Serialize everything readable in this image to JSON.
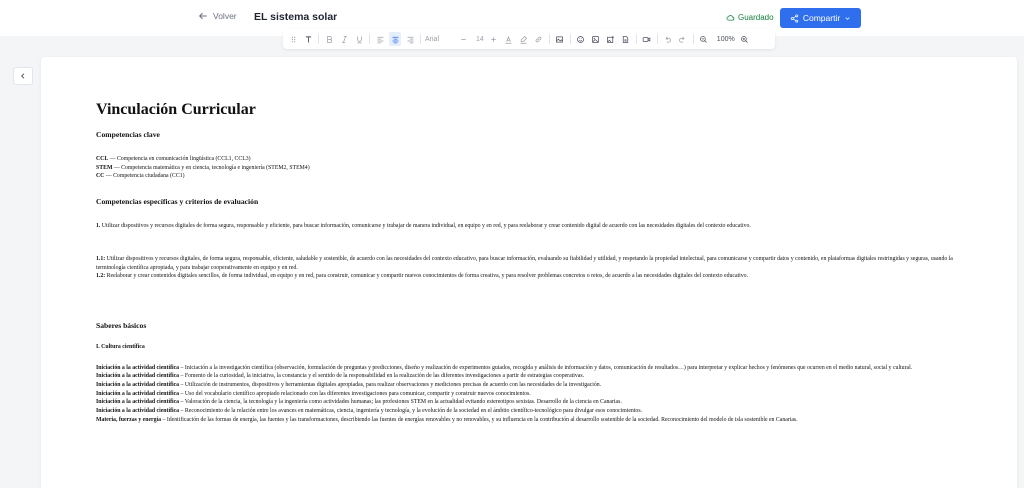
{
  "header": {
    "back_label": "Volver",
    "title": "EL sistema solar",
    "saved_label": "Guardado",
    "share_label": "Compartir"
  },
  "toolbar": {
    "font_name": "Arial",
    "font_size": "14",
    "zoom": "100%"
  },
  "document": {
    "title": "Vinculación Curricular",
    "competencias_clave": {
      "heading": "Competencias clave",
      "items": [
        {
          "code": "CCL",
          "text": " — Competencia en comunicación lingüística (CCL1, CCL3)"
        },
        {
          "code": "STEM",
          "text": " — Competencia matemática y en ciencia, tecnología e ingeniería (STEM2, STEM4)"
        },
        {
          "code": "CC",
          "text": " — Competencia ciudadana (CC1)"
        }
      ]
    },
    "competencias_especificas": {
      "heading": "Competencias específicas y criterios de evaluación",
      "item1": {
        "code": "1.",
        "text": " Utilizar dispositivos y recursos digitales de forma segura, responsable y eficiente, para buscar información, comunicarse y trabajar de manera individual, en equipo y en red, y para reelaborar y crear contenido digital de acuerdo con las necesidades digitales del contexto educativo."
      },
      "criterios": [
        {
          "code": "1.1:",
          "text": " Utilizar dispositivos y recursos digitales, de forma segura, responsable, eficiente, saludable y sostenible, de acuerdo con las necesidades del contexto educativo, para buscar información, evaluando su fiabilidad y utilidad, y respetando la propiedad intelectual, para comunicarse y compartir datos y contenido, en plataformas digitales restringidas y seguras, usando la terminología científica apropiada, y para trabajar cooperativamente en equipo y en red."
        },
        {
          "code": "1.2:",
          "text": " Reelaborar y crear contenidos digitales sencillos, de forma individual, en equipo y en red, para construir, comunicar y compartir nuevos conocimientos de forma creativa, y para resolver problemas concretos o retos, de acuerdo a las necesidades digitales del contexto educativo."
        }
      ]
    },
    "saberes": {
      "heading": "Saberes básicos",
      "subheading": "I. Cultura científica",
      "items": [
        {
          "code": "Iniciación a la actividad científica",
          "text": " – Iniciación a la investigación científica (observación, formulación de preguntas y predicciones, diseño y realización de experimentos guiados, recogida y análisis de información y datos, comunicación de resultados…) para interpretar y explicar hechos y fenómenes que ocurren en el medio natural, social y cultural."
        },
        {
          "code": "Iniciación a la actividad científica",
          "text": " – Fomento de la curiosidad, la iniciativa, la constancia y el sentido de la responsabilidad en la realización de las diferentes investigaciones a partir de estrategias cooperativas."
        },
        {
          "code": "Iniciación a la actividad científica",
          "text": " – Utilización de instrumentos, dispositivos y herramientas digitales apropiadas, para realizar observaciones y mediciones precisas de acuerdo con las necesidades de la investigación."
        },
        {
          "code": "Iniciación a la actividad científica",
          "text": " – Uso del vocabulario científico apropiado relacionado con las diferentes investigaciones para comunicar, compartir y construir nuevos conocimientos."
        },
        {
          "code": "Iniciación a la actividad científica",
          "text": " – Valoración de la ciencia, la tecnología y la ingeniería como actividades humanas; las profesiones STEM en la actualidad evitando estereotipos sexistas. Desarrollo de la ciencia en Canarias."
        },
        {
          "code": "Iniciación a la actividad científica",
          "text": " – Reconocimiento de la relación entre los avances en matemáticas, ciencia, ingeniería y tecnología, y la evolución de la sociedad en el ámbito científico-tecnológico para divulgar esos conocimientos."
        },
        {
          "code": "Materia, fuerzas y energía",
          "text": " – Identificación de las formas de energía, las fuentes y las transformaciones, describiendo las fuentes de energías renovables y no renovables, y su influencia en la contribución al desarrollo sostenible de la sociedad. Reconocimiento del modelo de isla sostenible en Canarias."
        }
      ]
    }
  }
}
